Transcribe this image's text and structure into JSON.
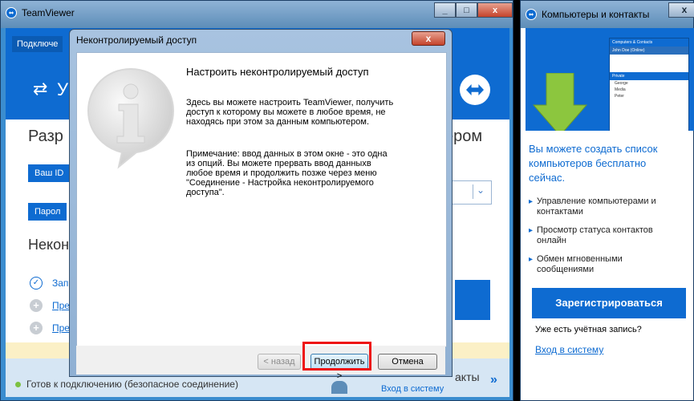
{
  "main_window": {
    "title": "TeamViewer",
    "minimize": "_",
    "maximize": "□",
    "close": "x",
    "nav_tab": "Подключе",
    "banner_partial": "У",
    "heading_left": "Разр",
    "heading_right": "ером",
    "your_id_btn": "Ваш ID",
    "password_btn": "Парол",
    "section_partial": "Некон",
    "link_1": "Зап",
    "link_2": "Пре",
    "link_3": "Пре",
    "status_text": "Готов к подключению (безопасное соединение)",
    "status_contacts": "акты",
    "status_login": "Вход в систему",
    "status_chevron": "»"
  },
  "dialog": {
    "title": "Неконтролируемый доступ",
    "close": "x",
    "heading": "Настроить неконтролируемый доступ",
    "para1_line1": "Здесь вы можете настроить TeamViewer, получить",
    "para1_line2": "доступ к которому вы можете в любое время, не",
    "para1_line3": "находясь при этом за данным компьютером.",
    "para2_line1": "Примечание: ввод данных в этом окне  - это одна",
    "para2_line2": "из опций. Вы можете прервать ввод данныхв",
    "para2_line3": "любое время и продолжить позже через меню",
    "para2_line4": "\"Соединение - Настройка неконтролируемого",
    "para2_line5": "доступа\".",
    "back_btn": "< назад",
    "next_btn": "Продолжить >",
    "cancel_btn": "Отмена"
  },
  "contacts_window": {
    "title": "Компьютеры и контакты",
    "close": "x",
    "mini_title": "Computers & Contacts",
    "mini_user": "John Doe (Online)",
    "mini_group": "Private",
    "mini_contact_1": "George",
    "mini_contact_2": "Media",
    "mini_contact_3": "Peter",
    "headline_line1": "Вы можете создать список",
    "headline_line2": "компьютеров бесплатно",
    "headline_line3": "сейчас.",
    "bullet1_line1": "Управление компьютерами и",
    "bullet1_line2": "контактами",
    "bullet2_line1": "Просмотр статуса контактов",
    "bullet2_line2": "онлайн",
    "bullet3_line1": "Обмен мгновенными",
    "bullet3_line2": "сообщениями",
    "register_btn": "Зарегистрироваться",
    "have_account": "Уже есть учётная запись?",
    "login_link": "Вход в систему"
  },
  "colors": {
    "accent": "#0e6bd1",
    "highlight": "#ee1111"
  }
}
